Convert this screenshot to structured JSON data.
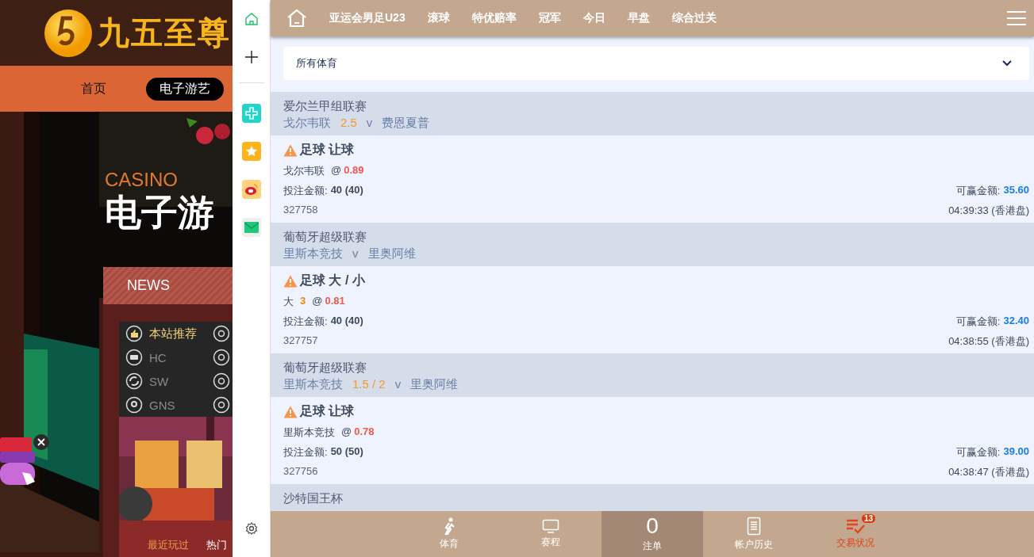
{
  "site": {
    "logo_text": "九五至尊",
    "nav": [
      {
        "label": "首页",
        "selected": false
      },
      {
        "label": "电子游艺",
        "selected": true
      }
    ],
    "banner": {
      "eyebrow": "CASINO",
      "title": "电子游"
    },
    "news": {
      "title": "NEWS",
      "providers": [
        {
          "label": "本站推荐",
          "selected": true
        },
        {
          "label": "HC",
          "selected": false
        },
        {
          "label": "SW",
          "selected": false
        },
        {
          "label": "GNS",
          "selected": false
        }
      ],
      "tabs": [
        {
          "label": "最近玩过",
          "selected": true
        },
        {
          "label": "热门",
          "selected": false
        }
      ]
    }
  },
  "sportsbook": {
    "menu": [
      "亚运会男足U23",
      "滚球",
      "特优赔率",
      "冠军",
      "今日",
      "早盘",
      "综合过关"
    ],
    "filter": {
      "value": "所有体育"
    },
    "bets": [
      {
        "league": "爱尔兰甲组联赛",
        "home": "戈尔韦联",
        "handicap": "2.5",
        "vs": "v",
        "away": "费恩夏普",
        "title": "足球 让球",
        "pick": "戈尔韦联",
        "at": "@",
        "odds": "0.89",
        "stake_label": "投注金额:",
        "stake": "40 (40)",
        "win_label": "可赢金额:",
        "win": "35.60",
        "id": "327758",
        "time": "04:39:33 (香港盘)"
      },
      {
        "league": "葡萄牙超级联赛",
        "home": "里斯本竞技",
        "vs": "v",
        "away": "里奥阿维",
        "title": "足球 大 / 小",
        "pick": "大",
        "line": "3",
        "at": "@",
        "odds": "0.81",
        "stake_label": "投注金额:",
        "stake": "40 (40)",
        "win_label": "可赢金额:",
        "win": "32.40",
        "id": "327757",
        "time": "04:38:55 (香港盘)"
      },
      {
        "league": "葡萄牙超级联赛",
        "home": "里斯本竞技",
        "handicap": "1.5 / 2",
        "vs": "v",
        "away": "里奥阿维",
        "title": "足球 让球",
        "pick": "里斯本竞技",
        "at": "@",
        "odds": "0.78",
        "stake_label": "投注金额:",
        "stake": "50 (50)",
        "win_label": "可赢金额:",
        "win": "39.00",
        "id": "327756",
        "time": "04:38:47 (香港盘)"
      }
    ],
    "next_league": "沙特国王杯",
    "bottom_nav": [
      {
        "kind": "sport",
        "label": "体育",
        "selected": false
      },
      {
        "kind": "schedule",
        "label": "赛程",
        "selected": false
      },
      {
        "kind": "count",
        "count": "0",
        "label": "注单",
        "selected": true
      },
      {
        "kind": "history",
        "label": "帐户历史",
        "selected": false
      },
      {
        "kind": "status",
        "label": "交易状况",
        "selected": false,
        "badge": "13"
      }
    ]
  }
}
